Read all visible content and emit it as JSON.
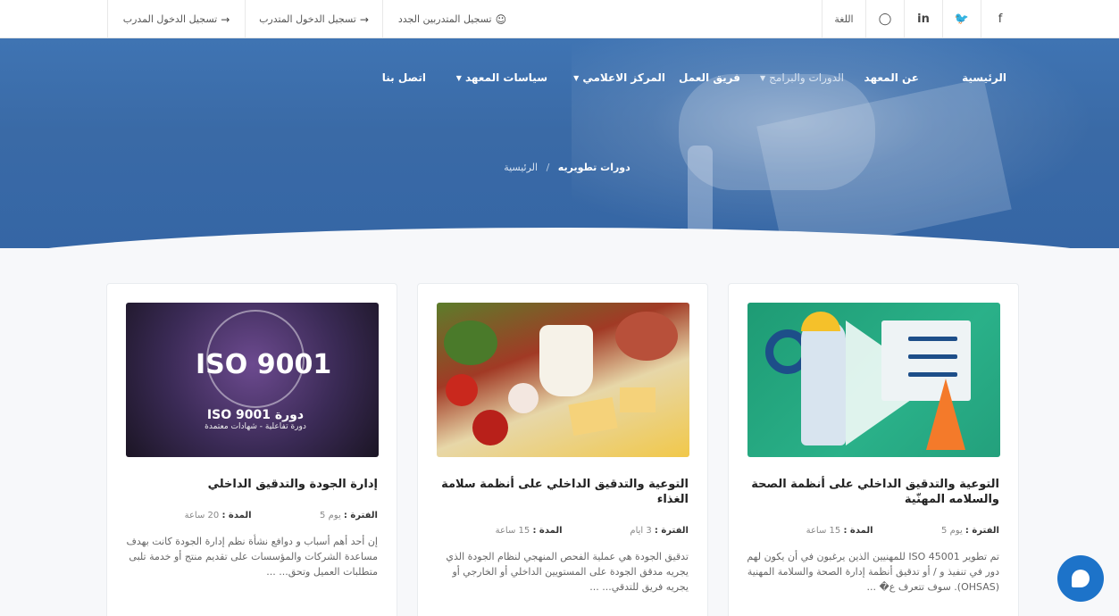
{
  "topbar": {
    "social": [
      "facebook-icon",
      "twitter-icon",
      "linkedin-icon",
      "instagram-icon"
    ],
    "language": "اللغة",
    "new_trainees": "تسجيل المتدربين الجدد",
    "trainee_login": "تسجيل الدخول المتدرب",
    "trainer_login": "تسجيل الدخول المدرب"
  },
  "nav": {
    "home": "الرئيسية",
    "about": "عن المعهد",
    "courses": "الدورات والبرامج",
    "team": "فريق العمل",
    "media": "المركز الاعلامي",
    "policies": "سياسات المعهد",
    "contact": "اتصل بنا"
  },
  "breadcrumb": {
    "home": "الرئيسية",
    "separator": "/",
    "current": "دورات تطويريه"
  },
  "cards": [
    {
      "title": "التوعية والتدقيق الداخلي على أنظمة الصحة والسلامه المهنّية",
      "period_label": "الفترة :",
      "period_value": "يوم 5",
      "duration_label": "المدة :",
      "duration_value": "15 ساعة",
      "description": "تم تطوير ISO 45001 للمهنيين الذين يرغبون في أن يكون لهم دور في تنفيذ و / أو تدقيق أنظمة إدارة الصحة والسلامة المهنية (OHSAS). سوف تتعرف ع� ..."
    },
    {
      "title": "التوعية والتدقيق الداخلي على أنظمة سلامة الغذاء",
      "period_label": "الفترة :",
      "period_value": "3 ايام",
      "duration_label": "المدة :",
      "duration_value": "15 ساعة",
      "description": "تدقيق الجودة هي عملية الفحص المنهجي لنظام الجودة الذي يجريه مدقق الجودة على المستويين الداخلي أو الخارجي أو يجريه فريق للتدقي... ..."
    },
    {
      "title": "إدارة الجودة والتدقيق الداخلي",
      "period_label": "الفترة :",
      "period_value": "يوم 5",
      "duration_label": "المدة :",
      "duration_value": "20 ساعة",
      "description": "إن أحد أهم أسباب و دوافع نشأة نظم إدارة الجودة كانت بهدف مساعدة الشركات والمؤسسات على تقديم منتج أو خدمة تلبى متطلبات العميل وتحق... ..."
    }
  ],
  "iso_image": {
    "big": "ISO 9001",
    "course": "دورة ISO 9001",
    "sub": "دورة تفاعلية - شهادات معتمدة"
  },
  "colors": {
    "hero": "#3a6aa6",
    "chat": "#1d73c9"
  }
}
